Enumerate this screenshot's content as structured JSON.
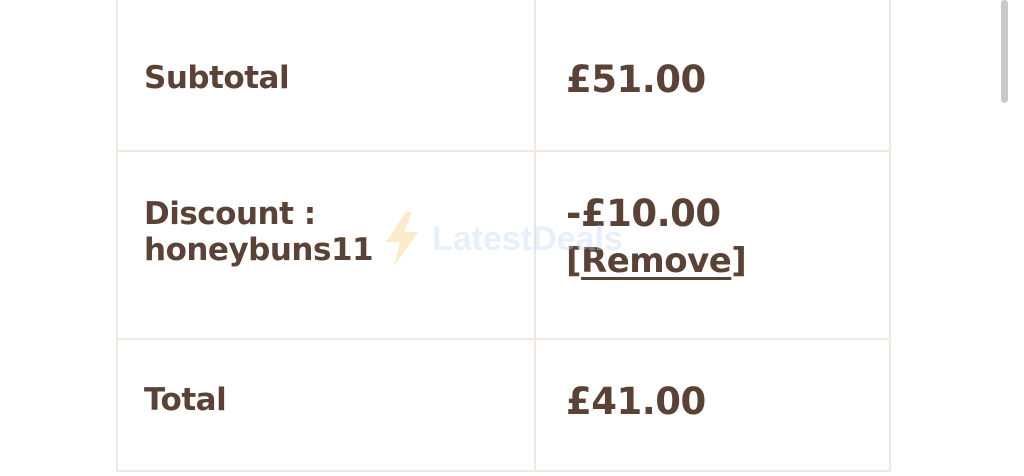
{
  "cart_totals": {
    "subtotal": {
      "label": "Subtotal",
      "value": "£51.00"
    },
    "discount": {
      "label": "Discount : honeybuns11",
      "value": "-£10.00",
      "remove_open": "[",
      "remove_label": "Remove",
      "remove_close": "]"
    },
    "total": {
      "label": "Total",
      "value": "£41.00"
    }
  },
  "watermark": {
    "text": "LatestDeals",
    "icon": "lightning-bolt-icon"
  },
  "colors": {
    "text": "#5a4336",
    "border": "#f1e9df",
    "watermark_text": "#bcd7f3",
    "watermark_bolt": "#f5c86a",
    "scrollbar": "#c9c9c9"
  }
}
